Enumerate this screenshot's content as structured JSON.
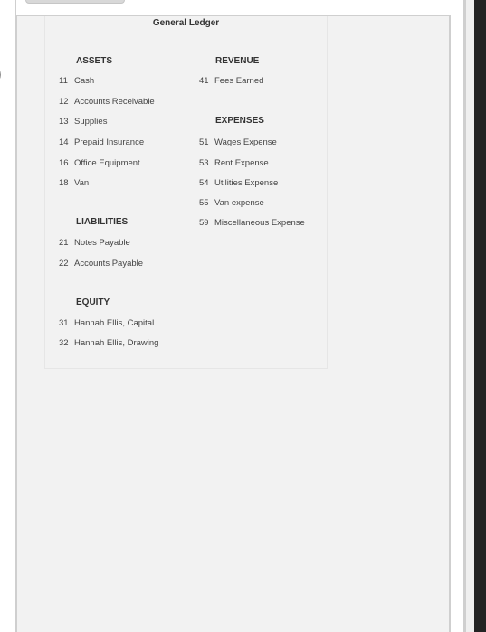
{
  "edge_glyph": ")",
  "ledger": {
    "title": "General Ledger",
    "left_column": [
      {
        "heading": "ASSETS",
        "accounts": [
          {
            "number": "11",
            "name": "Cash"
          },
          {
            "number": "12",
            "name": "Accounts Receivable"
          },
          {
            "number": "13",
            "name": "Supplies"
          },
          {
            "number": "14",
            "name": "Prepaid Insurance"
          },
          {
            "number": "16",
            "name": "Office Equipment"
          },
          {
            "number": "18",
            "name": "Van"
          }
        ]
      },
      {
        "heading": "LIABILITIES",
        "accounts": [
          {
            "number": "21",
            "name": "Notes Payable"
          },
          {
            "number": "22",
            "name": "Accounts Payable"
          }
        ]
      },
      {
        "heading": "EQUITY",
        "accounts": [
          {
            "number": "31",
            "name": "Hannah Ellis, Capital"
          },
          {
            "number": "32",
            "name": "Hannah Ellis, Drawing"
          }
        ]
      }
    ],
    "right_column": [
      {
        "heading": "REVENUE",
        "accounts": [
          {
            "number": "41",
            "name": "Fees Earned"
          }
        ]
      },
      {
        "heading": "EXPENSES",
        "accounts": [
          {
            "number": "51",
            "name": "Wages Expense"
          },
          {
            "number": "53",
            "name": "Rent Expense"
          },
          {
            "number": "54",
            "name": "Utilities Expense"
          },
          {
            "number": "55",
            "name": "Van expense"
          },
          {
            "number": "59",
            "name": "Miscellaneous Expense"
          }
        ]
      }
    ]
  }
}
